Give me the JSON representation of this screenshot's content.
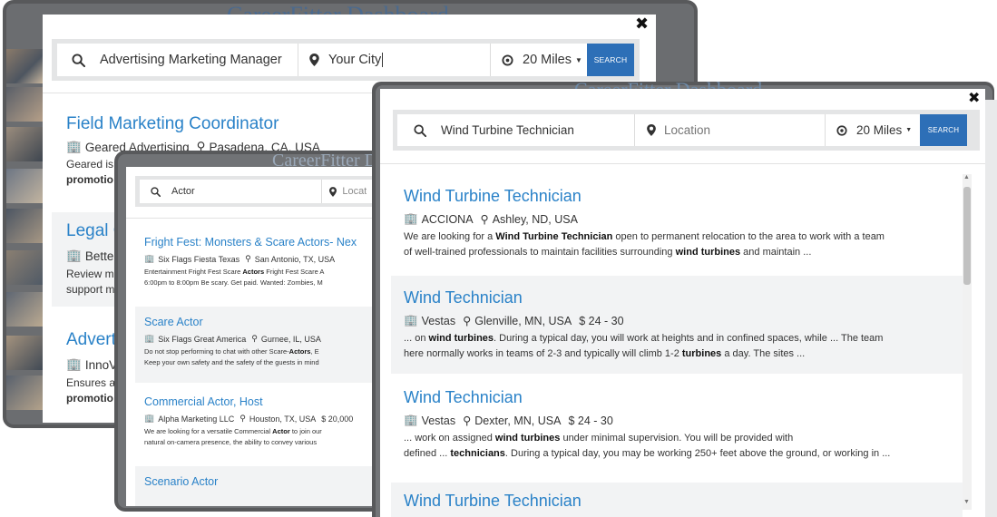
{
  "window_a": {
    "dash_title": "CareerFitter Dashboard",
    "search": {
      "keyword": "Advertising Marketing Manager",
      "location": "Your City",
      "radius": "20 Miles",
      "button": "SEARCH"
    },
    "jobs": [
      {
        "title": "Field Marketing Coordinator",
        "company": "Geared Advertising",
        "location": "Pasadena, CA, USA",
        "desc1": "Geared is",
        "desc2": "promotio"
      },
      {
        "title": "Legal C",
        "company": "Betterh",
        "desc1": "Review ma",
        "desc2": "support m"
      },
      {
        "title": "Advert",
        "company": "InnoVis",
        "desc1": "Ensures a",
        "desc2": "promotio"
      }
    ]
  },
  "window_b": {
    "ghost_title": "CareerFitter Dashboard",
    "search": {
      "keyword": "Actor",
      "location": "Locat"
    },
    "jobs": [
      {
        "title": "Fright Fest: Monsters & Scare Actors- Nex",
        "company": "Six Flags Fiesta Texas",
        "location": "San Antonio, TX, USA",
        "desc1_pre": "Entertainment Fright Fest Scare ",
        "desc1_bold": "Actors",
        "desc1_post": " Fright Fest Scare A",
        "desc2": "6:00pm to 8:00pm Be scary. Get paid. Wanted: Zombies, M"
      },
      {
        "title": "Scare Actor",
        "company": "Six Flags Great America",
        "location": "Gurnee, IL, USA",
        "desc1_pre": "Do not stop performing to chat with other Scare-",
        "desc1_bold": "Actors",
        "desc1_post": ", E",
        "desc2": "Keep your own safety and the safety of the guests in mind"
      },
      {
        "title": "Commercial Actor, Host",
        "company": "Alpha Marketing LLC",
        "location": "Houston, TX, USA",
        "salary": "$ 20,000",
        "desc1_pre": "We are looking for a versatile Commercial ",
        "desc1_bold": "Actor",
        "desc1_post": " to join our",
        "desc2": "natural on-camera presence, the ability to convey various"
      },
      {
        "title": "Scenario Actor"
      }
    ]
  },
  "window_c": {
    "ghost_title": "CareerFitter Dashboard",
    "search": {
      "keyword": "Wind Turbine Technician",
      "location_placeholder": "Location",
      "radius": "20 Miles",
      "button": "SEARCH"
    },
    "jobs": [
      {
        "title": "Wind Turbine Technician",
        "company": "ACCIONA",
        "location": "Ashley, ND, USA",
        "d1a": "We are looking for a ",
        "d1b": "Wind Turbine Technician",
        "d1c": " open to permanent relocation to the area to work with a team",
        "d2a": "of well-trained professionals to maintain facilities surrounding ",
        "d2b": "wind turbines",
        "d2c": " and maintain ..."
      },
      {
        "title": "Wind Technician",
        "company": "Vestas",
        "location": "Glenville, MN, USA",
        "salary": "$ 24 - 30",
        "d1a": "... on ",
        "d1b": "wind turbines",
        "d1c": ". During a typical day, you will work at heights and in confined spaces, while ... The team",
        "d2a": "here normally works in teams of 2-3 and typically will climb 1-2 ",
        "d2b": "turbines",
        "d2c": " a day. The sites ..."
      },
      {
        "title": "Wind Technician",
        "company": "Vestas",
        "location": "Dexter, MN, USA",
        "salary": "$ 24 - 30",
        "d1a": "... work on assigned ",
        "d1b": "wind turbines",
        "d1c": " under minimal supervision. You will be provided with",
        "d2a": "defined ... ",
        "d2b": "technicians",
        "d2c": ". During a typical day, you may be working 250+ feet above the ground, or working in ..."
      },
      {
        "title": "Wind Turbine Technician"
      }
    ]
  }
}
